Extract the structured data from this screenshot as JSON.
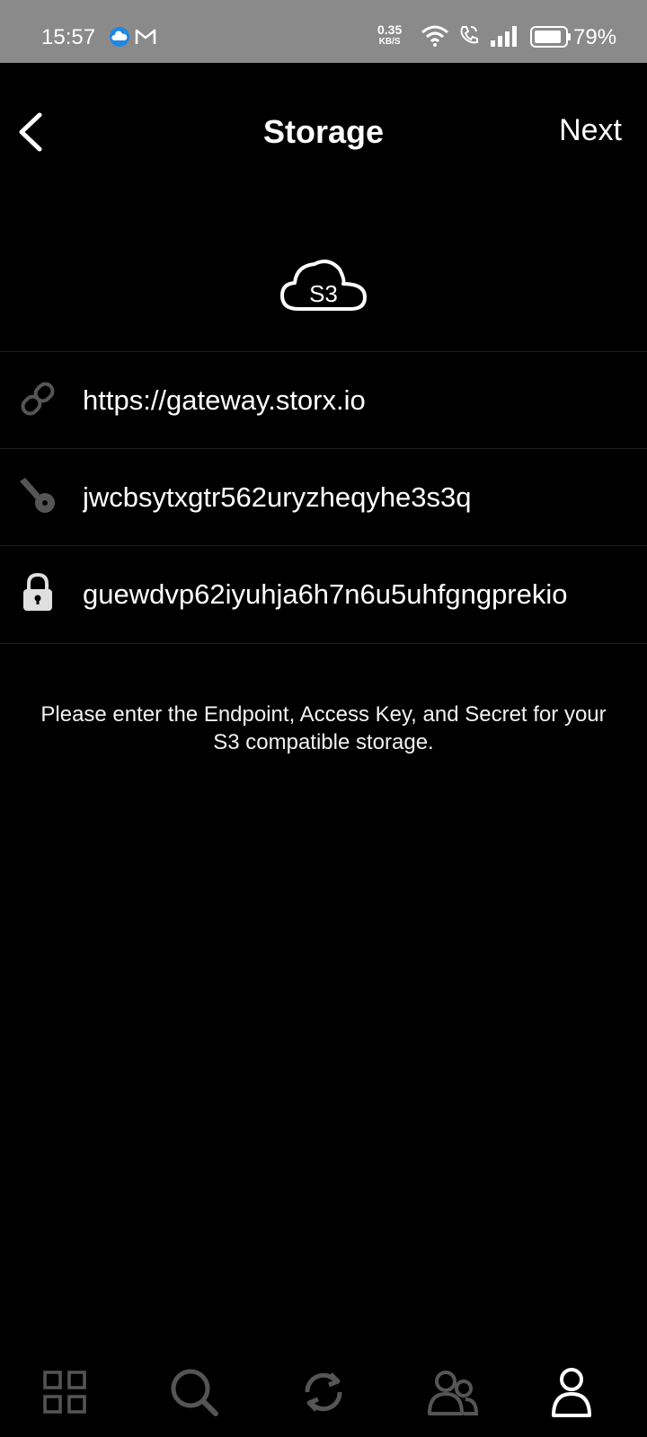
{
  "status": {
    "time": "15:57",
    "net_speed": "0.35",
    "net_unit": "KB/S",
    "battery": "79%",
    "icons": [
      "weather-cloud-icon",
      "gmail-icon",
      "wifi-icon",
      "wifi-call-icon",
      "signal-icon",
      "battery-icon"
    ]
  },
  "header": {
    "title": "Storage",
    "next_label": "Next"
  },
  "logo": {
    "text": "S3"
  },
  "fields": {
    "endpoint": "https://gateway.storx.io",
    "access_key": "jwcbsytxgtr562uryzheqyhe3s3q",
    "secret": "guewdvp62iyuhja6h7n6u5uhfgngprekio"
  },
  "hint": "Please enter the Endpoint, Access Key, and Secret for your S3 compatible storage.",
  "tabs": [
    "grid-icon",
    "search-icon",
    "sync-icon",
    "people-icon",
    "profile-icon"
  ],
  "colors": {
    "background": "#000000",
    "statusbar": "#8a8a8a",
    "icon_gray": "#555555",
    "active_tab": "#ffffff"
  }
}
